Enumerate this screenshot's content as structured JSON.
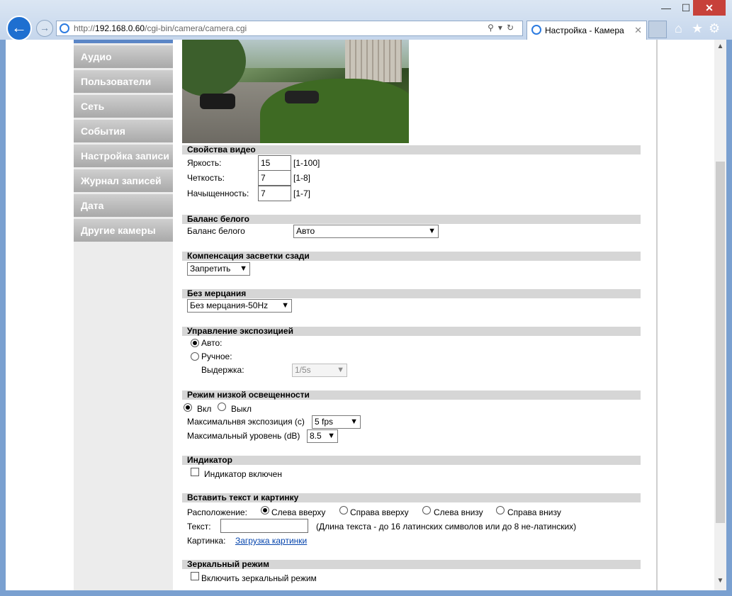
{
  "browser": {
    "url_prefix": "http://",
    "url_host": "192.168.0.60",
    "url_path": "/cgi-bin/camera/camera.cgi",
    "tab_title": "Настройка - Камера",
    "window_controls": {
      "minimize": "—",
      "maximize": "☐",
      "close": "✕"
    }
  },
  "sidebar": {
    "items": [
      {
        "label": "Аудио"
      },
      {
        "label": "Пользователи"
      },
      {
        "label": "Сеть"
      },
      {
        "label": "События"
      },
      {
        "label": "Настройка записи"
      },
      {
        "label": "Журнал записей"
      },
      {
        "label": "Дата"
      },
      {
        "label": "Другие камеры"
      }
    ]
  },
  "video_props": {
    "title": "Свойства видео",
    "brightness_label": "Яркость:",
    "brightness_value": "15",
    "brightness_range": "[1-100]",
    "sharpness_label": "Четкость:",
    "sharpness_value": "7",
    "sharpness_range": "[1-8]",
    "saturation_label": "Начыщенность:",
    "saturation_value": "7",
    "saturation_range": "[1-7]"
  },
  "white_balance": {
    "title": "Баланс белого",
    "label": "Баланс белого",
    "value": "Авто"
  },
  "backlight": {
    "title": "Компенсация засветки сзади",
    "value": "Запретить"
  },
  "flicker": {
    "title": "Без мерцания",
    "value": "Без мерцания-50Hz"
  },
  "exposure": {
    "title": "Управление экспозицией",
    "auto_label": "Авто:",
    "manual_label": "Ручное:",
    "shutter_label": "Выдержка:",
    "shutter_value": "1/5s",
    "selected": "auto"
  },
  "low_light": {
    "title": "Режим низкой освещенности",
    "on_label": "Вкл",
    "off_label": "Выкл",
    "selected": "on",
    "max_exposure_label": "Максимальнвя экспозиция (с)",
    "max_exposure_value": "5 fps",
    "max_level_label": "Максимальный уровень (dB)",
    "max_level_value": "8.5"
  },
  "indicator": {
    "title": "Индикатор",
    "checkbox_label": "Индикатор включен",
    "checked": false
  },
  "overlay": {
    "title": "Вставить текст и картинку",
    "position_label": "Расположение:",
    "positions": [
      "Слева вверху",
      "Справа вверху",
      "Слева внизу",
      "Справа внизу"
    ],
    "selected_position": "Слева вверху",
    "text_label": "Текст:",
    "text_value": "",
    "text_hint": "(Длина текста - до 16 латинских символов или до 8 не-латинских)",
    "image_label": "Картинка:",
    "image_link": "Загрузка картинки"
  },
  "mirror": {
    "title": "Зеркальный режим",
    "checkbox_label": "Включить зеркальный режим",
    "checked": false
  }
}
